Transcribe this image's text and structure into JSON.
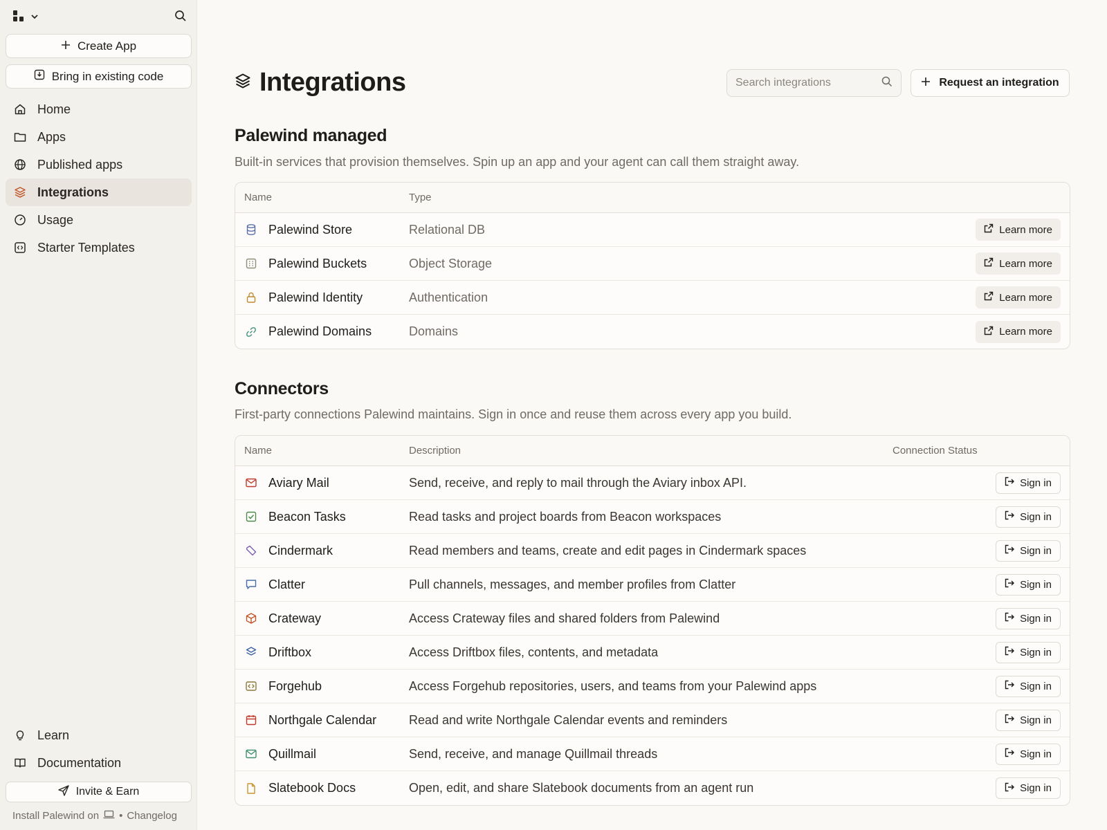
{
  "sidebar": {
    "create_app": "Create App",
    "bring_code": "Bring in existing code",
    "nav": [
      {
        "label": "Home",
        "icon": "home-icon"
      },
      {
        "label": "Apps",
        "icon": "folder-icon"
      },
      {
        "label": "Published apps",
        "icon": "globe-icon"
      },
      {
        "label": "Integrations",
        "icon": "layers-icon",
        "active": true
      },
      {
        "label": "Usage",
        "icon": "gauge-icon"
      },
      {
        "label": "Starter Templates",
        "icon": "template-icon"
      }
    ],
    "bottom": [
      {
        "label": "Learn",
        "icon": "lightbulb-icon"
      },
      {
        "label": "Documentation",
        "icon": "book-icon"
      }
    ],
    "invite": "Invite & Earn",
    "footer": {
      "install": "Install Palewind on",
      "separator": "•",
      "changelog": "Changelog"
    }
  },
  "header": {
    "title": "Integrations",
    "search_placeholder": "Search integrations",
    "request_label": "Request an integration"
  },
  "managed": {
    "title": "Palewind managed",
    "subtitle": "Built-in services that provision themselves. Spin up an app and your agent can call them straight away.",
    "columns": {
      "name": "Name",
      "type": "Type"
    },
    "action_label": "Learn more",
    "rows": [
      {
        "name": "Palewind Store",
        "type": "Relational DB",
        "icon": "database-icon",
        "color": "#5b6fa8"
      },
      {
        "name": "Palewind Buckets",
        "type": "Object Storage",
        "icon": "bucket-icon",
        "color": "#8a8f7a"
      },
      {
        "name": "Palewind Identity",
        "type": "Authentication",
        "icon": "lock-icon",
        "color": "#c08a2e"
      },
      {
        "name": "Palewind Domains",
        "type": "Domains",
        "icon": "link-icon",
        "color": "#3f8f7a"
      }
    ]
  },
  "connectors": {
    "title": "Connectors",
    "subtitle": "First-party connections Palewind maintains. Sign in once and reuse them across every app you build.",
    "columns": {
      "name": "Name",
      "description": "Description",
      "status": "Connection Status"
    },
    "action_label": "Sign in",
    "rows": [
      {
        "name": "Aviary Mail",
        "description": "Send, receive, and reply to mail through the Aviary inbox API.",
        "icon": "mail-icon",
        "color": "#c0392b"
      },
      {
        "name": "Beacon Tasks",
        "description": "Read tasks and project boards from Beacon workspaces",
        "icon": "checkbox-icon",
        "color": "#4f8a4a"
      },
      {
        "name": "Cindermark",
        "description": "Read members and teams, create and edit pages in Cindermark spaces",
        "icon": "tag-icon",
        "color": "#7b5fb0"
      },
      {
        "name": "Clatter",
        "description": "Pull channels, messages, and member profiles from Clatter",
        "icon": "chat-icon",
        "color": "#4a6fa8"
      },
      {
        "name": "Crateway",
        "description": "Access Crateway files and shared folders from Palewind",
        "icon": "box-icon",
        "color": "#c0562b"
      },
      {
        "name": "Driftbox",
        "description": "Access Driftbox files, contents, and metadata",
        "icon": "layers-icon",
        "color": "#3a5fa0"
      },
      {
        "name": "Forgehub",
        "description": "Access Forgehub repositories, users, and teams from your Palewind apps",
        "icon": "code-icon",
        "color": "#8a7a3a"
      },
      {
        "name": "Northgale Calendar",
        "description": "Read and write Northgale Calendar events and reminders",
        "icon": "calendar-icon",
        "color": "#c0392b"
      },
      {
        "name": "Quillmail",
        "description": "Send, receive, and manage Quillmail threads",
        "icon": "envelope-icon",
        "color": "#3f8f6a"
      },
      {
        "name": "Slatebook Docs",
        "description": "Open, edit, and share Slatebook documents from an agent run",
        "icon": "doc-icon",
        "color": "#c9952e"
      }
    ]
  },
  "colors": {
    "accent": "#c0562b",
    "sidebar_bg": "#f3f1ec",
    "page_bg": "#faf9f6"
  }
}
